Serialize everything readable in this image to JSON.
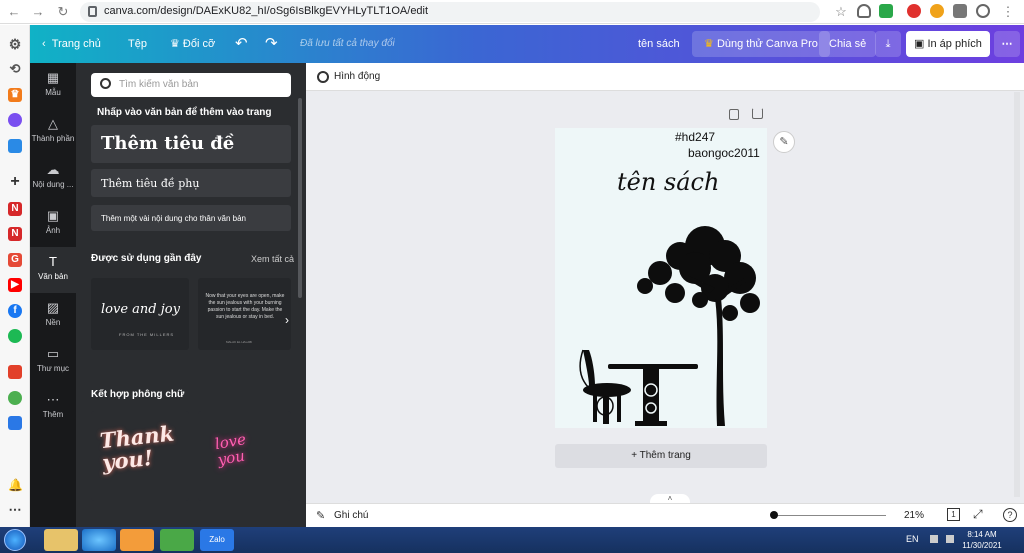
{
  "browser": {
    "url": "canva.com/design/DAExKU82_hI/oSg6IsBlkgEVYHLyTLT1OA/edit"
  },
  "topbar": {
    "home": "Trang chủ",
    "file": "Tệp",
    "resize": "Đổi cỡ",
    "saved": "Đã lưu tất cả thay đổi",
    "title": "tên sách",
    "pro": "Dùng thử Canva Pro",
    "share": "Chia sẻ",
    "print": "In áp phích"
  },
  "nav": [
    {
      "label": "Mẫu"
    },
    {
      "label": "Thành phần"
    },
    {
      "label": "Nội dung ..."
    },
    {
      "label": "Ảnh"
    },
    {
      "label": "Văn bản"
    },
    {
      "label": "Nền"
    },
    {
      "label": "Thư mục"
    },
    {
      "label": "Thêm"
    }
  ],
  "panel": {
    "search_placeholder": "Tìm kiếm văn bản",
    "click_hint": "Nhấp vào văn bản để thêm vào trang",
    "add_heading": "Thêm tiêu đề",
    "add_subheading": "Thêm tiêu đề phụ",
    "add_body": "Thêm một vài nội dung cho thân văn bản",
    "recent_title": "Được sử dụng gần đây",
    "see_all": "Xem tất cả",
    "recent_card1_main": "love and joy",
    "recent_card1_sub": "FROM THE MILLERS",
    "recent_card2_main": "Now that your eyes are open, make the sun jealous with your burning passion to start the day. Make the sun jealous or stay in bed.",
    "recent_card2_sub": "MALAK EL HALABI",
    "combos_title": "Kết hợp phông chữ",
    "combo1": "Thank you!",
    "combo2": "love you"
  },
  "editor": {
    "animate": "Hình động",
    "notes": "Ghi chú",
    "zoom": "21%",
    "page_count": "1",
    "add_page": "+ Thêm trang"
  },
  "design": {
    "line1": "#hd247",
    "line2": "baongoc2011",
    "title": "tên sách"
  },
  "taskbar": {
    "lang": "EN",
    "time": "8:14 AM",
    "date": "11/30/2021"
  },
  "colors": {
    "accent_start": "#10b2c6",
    "accent_end": "#6d3fe0",
    "panel_bg": "#2b2d30",
    "nav_bg": "#18191b"
  }
}
